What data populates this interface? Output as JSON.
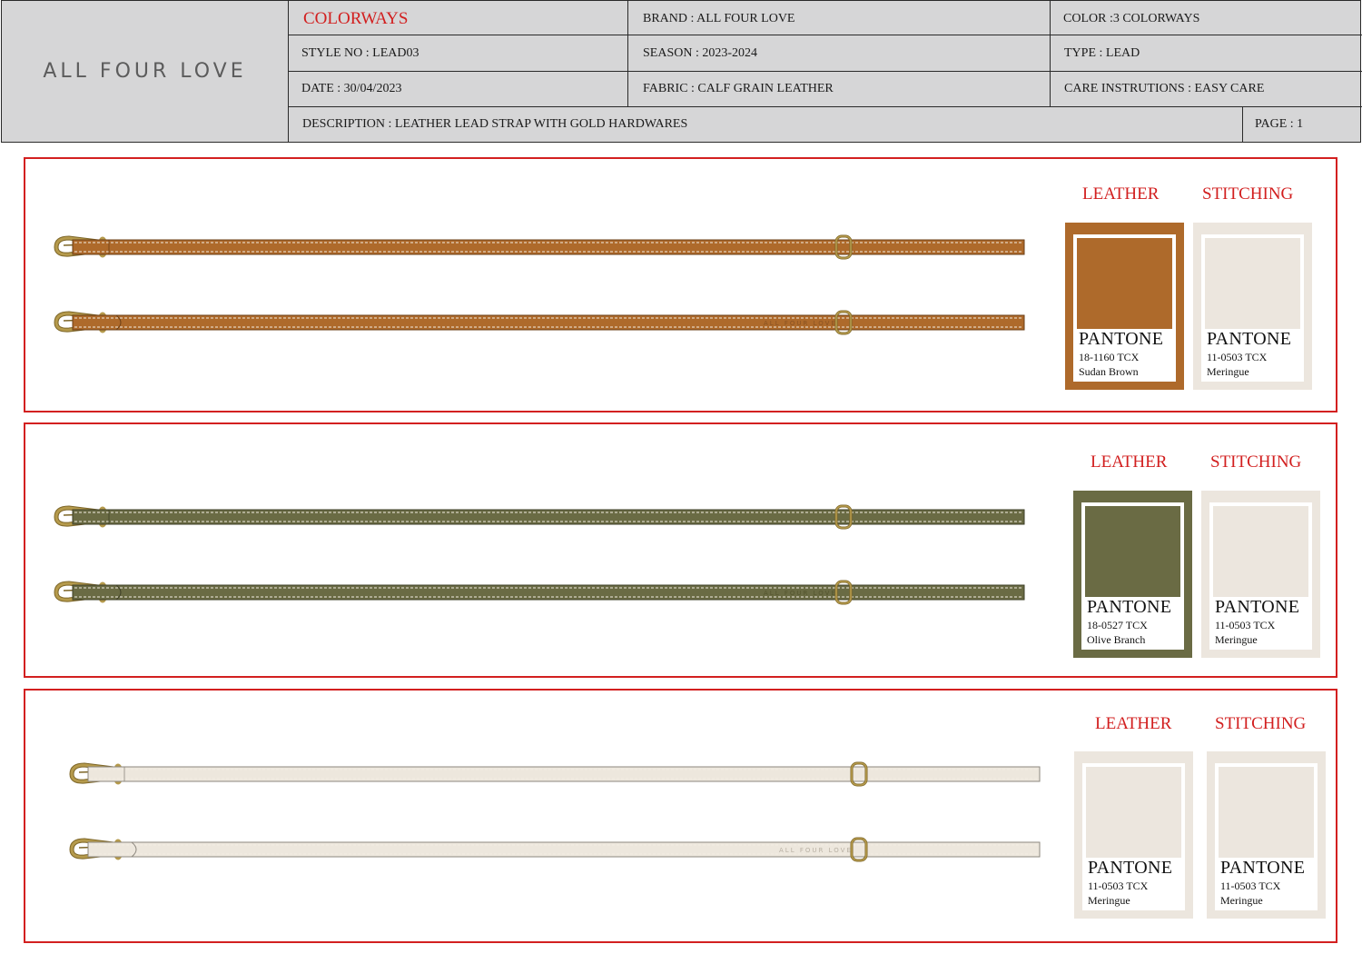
{
  "header": {
    "logo": "ALL FOUR LOVE",
    "title": "COLORWAYS",
    "brand": "BRAND : ALL FOUR LOVE",
    "color": "COLOR :3 COLORWAYS",
    "style_no": "STYLE NO : LEAD03",
    "season": "SEASON : 2023-2024",
    "type": "TYPE : LEAD",
    "date": "DATE  : 30/04/2023",
    "fabric": "FABRIC : CALF GRAIN LEATHER",
    "care": "CARE INSTRUTIONS : EASY CARE",
    "description": "DESCRIPTION : LEATHER LEAD STRAP WITH GOLD HARDWARES",
    "page": "PAGE : 1"
  },
  "strap_brand_stamp": "ALL FOUR LOVE",
  "colorways": [
    {
      "strap_color": "#ae6a2b",
      "strap_edge": "#6b3f17",
      "stamp_color": "#8a5322",
      "leather_label": "LEATHER",
      "stitching_label": "STITCHING",
      "leather": {
        "pantone": "PANTONE",
        "code": "18-1160 TCX",
        "name": "Sudan Brown",
        "color": "#ae6a2b"
      },
      "stitching": {
        "pantone": "PANTONE",
        "code": "11-0503 TCX",
        "name": "Meringue",
        "color": "#ece6de"
      }
    },
    {
      "strap_color": "#6a6b44",
      "strap_edge": "#3e3f27",
      "stamp_color": "#55562f",
      "leather_label": "LEATHER",
      "stitching_label": "STITCHING",
      "leather": {
        "pantone": "PANTONE",
        "code": "18-0527 TCX",
        "name": "Olive Branch",
        "color": "#6a6b44"
      },
      "stitching": {
        "pantone": "PANTONE",
        "code": "11-0503 TCX",
        "name": "Meringue",
        "color": "#ece6de"
      }
    },
    {
      "strap_color": "#ede7dd",
      "strap_edge": "#8c877e",
      "stamp_color": "#b9b1a4",
      "leather_label": "LEATHER",
      "stitching_label": "STITCHING",
      "leather": {
        "pantone": "PANTONE",
        "code": "11-0503 TCX",
        "name": "Meringue",
        "color": "#ece6de"
      },
      "stitching": {
        "pantone": "PANTONE",
        "code": "11-0503 TCX",
        "name": "Meringue",
        "color": "#ece6de"
      }
    }
  ],
  "colors": {
    "accent_red": "#d21f1f",
    "header_bg": "#d6d6d7",
    "gold": "#b59a4c"
  }
}
